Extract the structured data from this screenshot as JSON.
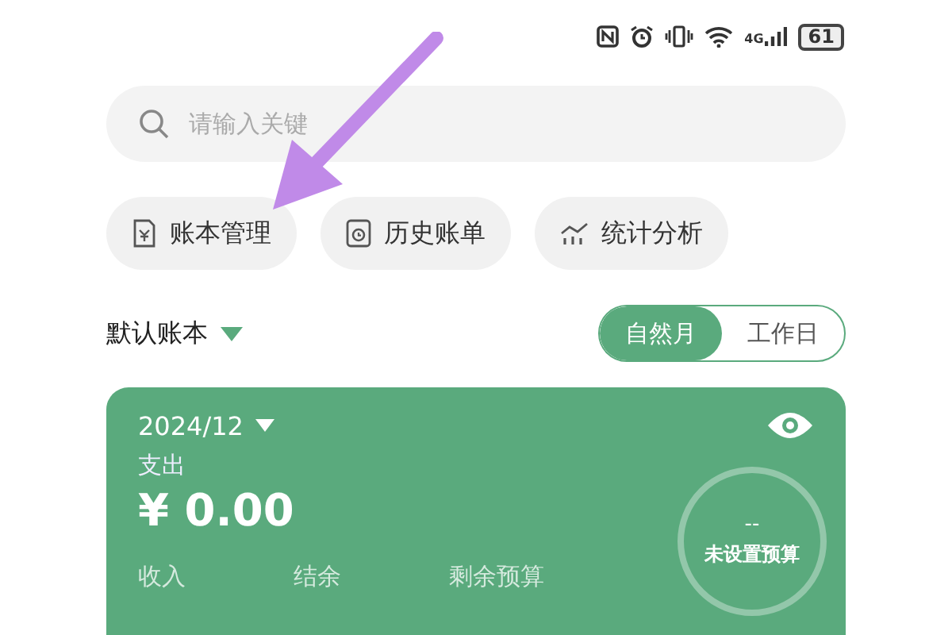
{
  "status_bar": {
    "network": "4G",
    "battery": "61"
  },
  "search": {
    "placeholder": "请输入关键"
  },
  "shortcuts": [
    {
      "label": "账本管理",
      "kind": "ledger"
    },
    {
      "label": "历史账单",
      "kind": "history"
    },
    {
      "label": "统计分析",
      "kind": "stats"
    }
  ],
  "ledger_selector": {
    "label": "默认账本"
  },
  "period_toggle": [
    {
      "label": "自然月",
      "selected": true
    },
    {
      "label": "工作日",
      "selected": false
    }
  ],
  "summary_card": {
    "month": "2024/12",
    "expense_label": "支出",
    "expense_amount": "¥ 0.00",
    "budget_value": "--",
    "budget_label": "未设置预算",
    "bottom_labels": [
      "收入",
      "结余",
      "剩余预算"
    ]
  }
}
